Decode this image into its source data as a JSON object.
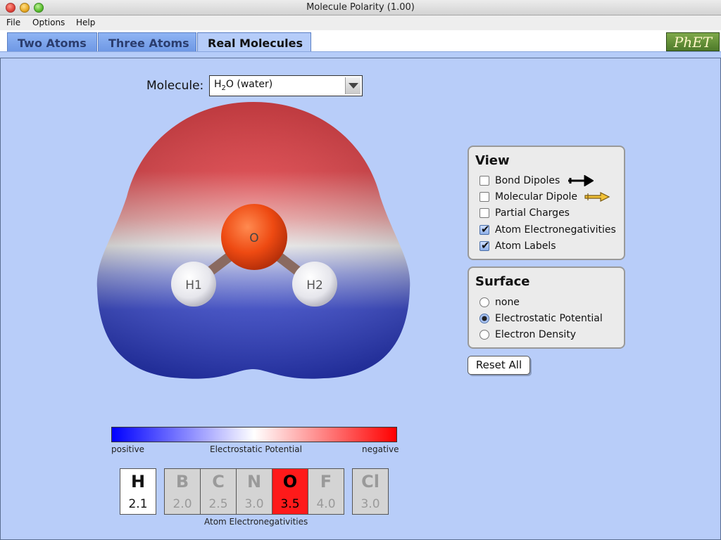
{
  "window": {
    "title": "Molecule Polarity (1.00)"
  },
  "menu": [
    "File",
    "Options",
    "Help"
  ],
  "tabs": [
    {
      "label": "Two Atoms"
    },
    {
      "label": "Three Atoms"
    },
    {
      "label": "Real Molecules"
    }
  ],
  "logo": {
    "text": "PhET"
  },
  "molecule": {
    "label": "Molecule:",
    "selected": "H2O (water)",
    "selected_prefix": "H",
    "selected_sub": "2",
    "selected_suffix": "O (water)",
    "atoms": [
      "O",
      "H1",
      "H2"
    ]
  },
  "view_panel": {
    "title": "View",
    "items": [
      {
        "label": "Bond Dipoles",
        "checked": false,
        "icon": "bond-dipole-arrow-icon"
      },
      {
        "label": "Molecular Dipole",
        "checked": false,
        "icon": "molecular-dipole-arrow-icon"
      },
      {
        "label": "Partial Charges",
        "checked": false
      },
      {
        "label": "Atom Electronegativities",
        "checked": true
      },
      {
        "label": "Atom Labels",
        "checked": true
      }
    ]
  },
  "surface_panel": {
    "title": "Surface",
    "options": [
      {
        "label": "none",
        "selected": false
      },
      {
        "label": "Electrostatic Potential",
        "selected": true
      },
      {
        "label": "Electron Density",
        "selected": false
      }
    ]
  },
  "reset_label": "Reset All",
  "potential_key": {
    "left": "positive",
    "center": "Electrostatic Potential",
    "right": "negative",
    "colors": {
      "positive": "#0000ff",
      "neutral": "#ffffff",
      "negative": "#ff0000"
    }
  },
  "electronegativities": {
    "caption": "Atom Electronegativities",
    "elements": [
      {
        "symbol": "H",
        "value": "2.1",
        "state": "highlight-white"
      },
      {
        "symbol": "B",
        "value": "2.0",
        "state": "inactive"
      },
      {
        "symbol": "C",
        "value": "2.5",
        "state": "inactive"
      },
      {
        "symbol": "N",
        "value": "3.0",
        "state": "inactive"
      },
      {
        "symbol": "O",
        "value": "3.5",
        "state": "highlight-red"
      },
      {
        "symbol": "F",
        "value": "4.0",
        "state": "inactive"
      },
      {
        "symbol": "Cl",
        "value": "3.0",
        "state": "inactive"
      }
    ]
  }
}
